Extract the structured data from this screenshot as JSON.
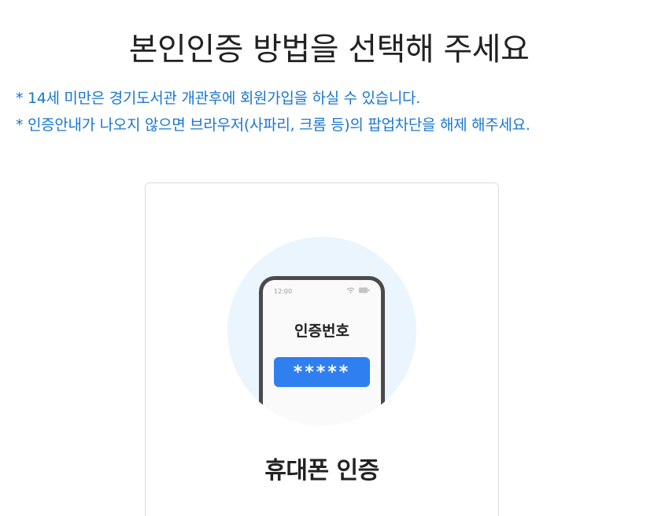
{
  "header": {
    "title": "본인인증 방법을 선택해 주세요"
  },
  "notices": [
    "* 14세 미만은 경기도서관 개관후에 회원가입을 하실 수 있습니다.",
    "* 인증안내가 나오지 않으면 브라우저(사파리, 크롬 등)의 팝업차단을 해제 해주세요."
  ],
  "colors": {
    "notice_text": "#1976d2",
    "illustration_bg": "#eaf5fe",
    "code_box": "#2f7ff0"
  },
  "auth_option": {
    "label": "휴대폰 인증",
    "illustration": {
      "phone_time": "12:00",
      "phone_label": "인증번호",
      "code_mask": "*****",
      "icons": [
        "wifi-icon",
        "battery-icon"
      ]
    }
  }
}
